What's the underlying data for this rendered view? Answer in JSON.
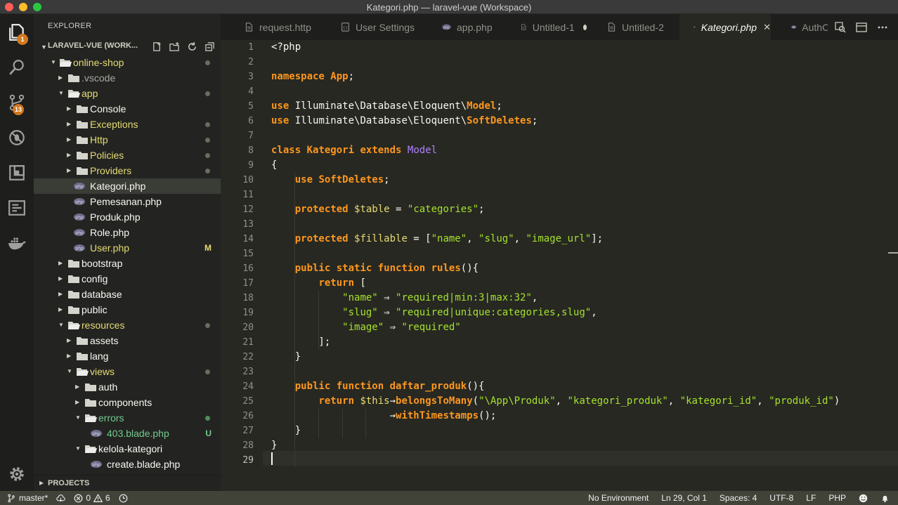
{
  "window": {
    "title": "Kategori.php — laravel-vue (Workspace)"
  },
  "activity_bar": {
    "explorer_badge": "1",
    "scm_badge": "13"
  },
  "sidebar": {
    "header": "EXPLORER",
    "workspace_label": "LARAVEL-VUE (WORK...",
    "projects_label": "PROJECTS",
    "tree": [
      {
        "label": "online-shop",
        "level": 0,
        "type": "folder",
        "open": true,
        "color": "#e6db74",
        "marker": "dot"
      },
      {
        "label": ".vscode",
        "level": 1,
        "type": "folder",
        "open": false,
        "color": "#a8a8a0",
        "marker": ""
      },
      {
        "label": "app",
        "level": 1,
        "type": "folder",
        "open": true,
        "color": "#e6db74",
        "marker": "dot"
      },
      {
        "label": "Console",
        "level": 2,
        "type": "folder",
        "open": false,
        "color": "#f8f8f2",
        "marker": ""
      },
      {
        "label": "Exceptions",
        "level": 2,
        "type": "folder",
        "open": false,
        "color": "#e6db74",
        "marker": "dot"
      },
      {
        "label": "Http",
        "level": 2,
        "type": "folder",
        "open": false,
        "color": "#e6db74",
        "marker": "dot"
      },
      {
        "label": "Policies",
        "level": 2,
        "type": "folder",
        "open": false,
        "color": "#e6db74",
        "marker": "dot"
      },
      {
        "label": "Providers",
        "level": 2,
        "type": "folder",
        "open": false,
        "color": "#e6db74",
        "marker": "dot"
      },
      {
        "label": "Kategori.php",
        "level": 2,
        "type": "file",
        "color": "#f8f8f2",
        "marker": "",
        "selected": true
      },
      {
        "label": "Pemesanan.php",
        "level": 2,
        "type": "file",
        "color": "#f8f8f2",
        "marker": ""
      },
      {
        "label": "Produk.php",
        "level": 2,
        "type": "file",
        "color": "#f8f8f2",
        "marker": ""
      },
      {
        "label": "Role.php",
        "level": 2,
        "type": "file",
        "color": "#f8f8f2",
        "marker": ""
      },
      {
        "label": "User.php",
        "level": 2,
        "type": "file",
        "color": "#e6db74",
        "marker": "M"
      },
      {
        "label": "bootstrap",
        "level": 1,
        "type": "folder",
        "open": false,
        "color": "#f8f8f2",
        "marker": ""
      },
      {
        "label": "config",
        "level": 1,
        "type": "folder",
        "open": false,
        "color": "#f8f8f2",
        "marker": ""
      },
      {
        "label": "database",
        "level": 1,
        "type": "folder",
        "open": false,
        "color": "#f8f8f2",
        "marker": ""
      },
      {
        "label": "public",
        "level": 1,
        "type": "folder",
        "open": false,
        "color": "#f8f8f2",
        "marker": ""
      },
      {
        "label": "resources",
        "level": 1,
        "type": "folder",
        "open": true,
        "color": "#e6db74",
        "marker": "dot"
      },
      {
        "label": "assets",
        "level": 2,
        "type": "folder",
        "open": false,
        "color": "#f8f8f2",
        "marker": ""
      },
      {
        "label": "lang",
        "level": 2,
        "type": "folder",
        "open": false,
        "color": "#f8f8f2",
        "marker": ""
      },
      {
        "label": "views",
        "level": 2,
        "type": "folder",
        "open": true,
        "color": "#e6db74",
        "marker": "dot"
      },
      {
        "label": "auth",
        "level": 3,
        "type": "folder",
        "open": false,
        "color": "#f8f8f2",
        "marker": ""
      },
      {
        "label": "components",
        "level": 3,
        "type": "folder",
        "open": false,
        "color": "#f8f8f2",
        "marker": ""
      },
      {
        "label": "errors",
        "level": 3,
        "type": "folder",
        "open": true,
        "color": "#73c990",
        "marker": "greendot"
      },
      {
        "label": "403.blade.php",
        "level": 4,
        "type": "file",
        "color": "#73c990",
        "marker": "U"
      },
      {
        "label": "kelola-kategori",
        "level": 3,
        "type": "folder",
        "open": true,
        "color": "#f8f8f2",
        "marker": ""
      },
      {
        "label": "create.blade.php",
        "level": 4,
        "type": "file",
        "color": "#f8f8f2",
        "marker": ""
      }
    ]
  },
  "tabs": [
    {
      "label": "request.http",
      "icon": "file-icon",
      "active": false,
      "dirty": false
    },
    {
      "label": "User Settings",
      "icon": "settings-file-icon",
      "active": false,
      "dirty": false
    },
    {
      "label": "app.php",
      "icon": "php-icon",
      "active": false,
      "dirty": false
    },
    {
      "label": "Untitled-1",
      "icon": "file-icon",
      "active": false,
      "dirty": true
    },
    {
      "label": "Untitled-2",
      "icon": "file-icon",
      "active": false,
      "dirty": false
    },
    {
      "label": "Kategori.php",
      "icon": "php-icon",
      "active": true,
      "dirty": false
    },
    {
      "label": "AuthCo",
      "icon": "php-icon",
      "active": false,
      "dirty": false
    }
  ],
  "editor": {
    "current_line": 29,
    "lines": [
      [
        [
          "plain",
          "<?php"
        ]
      ],
      [],
      [
        [
          "kw2",
          "namespace"
        ],
        [
          "plain",
          " "
        ],
        [
          "cls",
          "App"
        ],
        [
          "plain",
          ";"
        ]
      ],
      [],
      [
        [
          "kw2",
          "use"
        ],
        [
          "plain",
          " Illuminate\\Database\\Eloquent\\"
        ],
        [
          "cls",
          "Model"
        ],
        [
          "plain",
          ";"
        ]
      ],
      [
        [
          "kw2",
          "use"
        ],
        [
          "plain",
          " Illuminate\\Database\\Eloquent\\"
        ],
        [
          "cls",
          "SoftDeletes"
        ],
        [
          "plain",
          ";"
        ]
      ],
      [],
      [
        [
          "kw2",
          "class"
        ],
        [
          "plain",
          " "
        ],
        [
          "cls",
          "Kategori"
        ],
        [
          "plain",
          " "
        ],
        [
          "kw2",
          "extends"
        ],
        [
          "plain",
          " "
        ],
        [
          "ty",
          "Model"
        ]
      ],
      [
        [
          "plain",
          "{"
        ]
      ],
      [
        [
          "plain",
          "    "
        ],
        [
          "kw2",
          "use"
        ],
        [
          "plain",
          " "
        ],
        [
          "cls",
          "SoftDeletes"
        ],
        [
          "plain",
          ";"
        ]
      ],
      [],
      [
        [
          "plain",
          "    "
        ],
        [
          "kw2",
          "protected"
        ],
        [
          "plain",
          " "
        ],
        [
          "var",
          "$table"
        ],
        [
          "plain",
          " = "
        ],
        [
          "str",
          "\"categories\""
        ],
        [
          "plain",
          ";"
        ]
      ],
      [],
      [
        [
          "plain",
          "    "
        ],
        [
          "kw2",
          "protected"
        ],
        [
          "plain",
          " "
        ],
        [
          "var",
          "$fillable"
        ],
        [
          "plain",
          " = ["
        ],
        [
          "str",
          "\"name\""
        ],
        [
          "plain",
          ", "
        ],
        [
          "str",
          "\"slug\""
        ],
        [
          "plain",
          ", "
        ],
        [
          "str",
          "\"image_url\""
        ],
        [
          "plain",
          "];"
        ]
      ],
      [],
      [
        [
          "plain",
          "    "
        ],
        [
          "kw2",
          "public"
        ],
        [
          "plain",
          " "
        ],
        [
          "kw2",
          "static"
        ],
        [
          "plain",
          " "
        ],
        [
          "kw2",
          "function"
        ],
        [
          "plain",
          " "
        ],
        [
          "fn",
          "rules"
        ],
        [
          "plain",
          "(){"
        ]
      ],
      [
        [
          "plain",
          "        "
        ],
        [
          "kw2",
          "return"
        ],
        [
          "plain",
          " ["
        ]
      ],
      [
        [
          "plain",
          "            "
        ],
        [
          "str",
          "\"name\""
        ],
        [
          "plain",
          " ⇒ "
        ],
        [
          "str",
          "\"required|min:3|max:32\""
        ],
        [
          "plain",
          ","
        ]
      ],
      [
        [
          "plain",
          "            "
        ],
        [
          "str",
          "\"slug\""
        ],
        [
          "plain",
          " ⇒ "
        ],
        [
          "str",
          "\"required|unique:categories,slug\""
        ],
        [
          "plain",
          ","
        ]
      ],
      [
        [
          "plain",
          "            "
        ],
        [
          "str",
          "\"image\""
        ],
        [
          "plain",
          " ⇒ "
        ],
        [
          "str",
          "\"required\""
        ]
      ],
      [
        [
          "plain",
          "        ];"
        ]
      ],
      [
        [
          "plain",
          "    }"
        ]
      ],
      [],
      [
        [
          "plain",
          "    "
        ],
        [
          "kw2",
          "public"
        ],
        [
          "plain",
          " "
        ],
        [
          "kw2",
          "function"
        ],
        [
          "plain",
          " "
        ],
        [
          "fn",
          "daftar_produk"
        ],
        [
          "plain",
          "(){"
        ]
      ],
      [
        [
          "plain",
          "        "
        ],
        [
          "kw2",
          "return"
        ],
        [
          "plain",
          " "
        ],
        [
          "var",
          "$this"
        ],
        [
          "plain",
          "→"
        ],
        [
          "fn",
          "belongsToMany"
        ],
        [
          "plain",
          "("
        ],
        [
          "str",
          "\"\\App\\Produk\""
        ],
        [
          "plain",
          ", "
        ],
        [
          "str",
          "\"kategori_produk\""
        ],
        [
          "plain",
          ", "
        ],
        [
          "str",
          "\"kategori_id\""
        ],
        [
          "plain",
          ", "
        ],
        [
          "str",
          "\"produk_id\""
        ],
        [
          "plain",
          ")"
        ]
      ],
      [
        [
          "plain",
          "                    →"
        ],
        [
          "fn",
          "withTimestamps"
        ],
        [
          "plain",
          "();"
        ]
      ],
      [
        [
          "plain",
          "    }"
        ]
      ],
      [
        [
          "plain",
          "}"
        ]
      ],
      []
    ]
  },
  "statusbar": {
    "branch": "master*",
    "errors": "0",
    "warnings": "6",
    "environment": "No Environment",
    "position": "Ln 29, Col 1",
    "spaces": "Spaces: 4",
    "encoding": "UTF-8",
    "eol": "LF",
    "language": "PHP"
  },
  "colors": {
    "accent_badge": "#d2781e",
    "modified_yellow": "#e6db74",
    "untracked_green": "#73c990"
  }
}
